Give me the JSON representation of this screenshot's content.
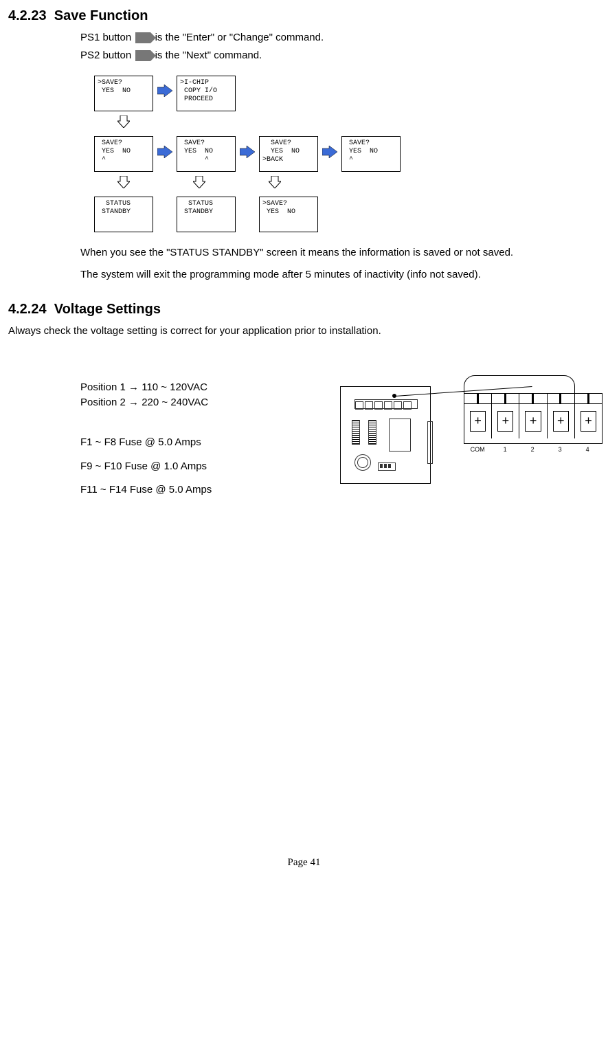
{
  "sec_save": {
    "num": "4.2.23",
    "title": "Save Function",
    "ps1_pre": "PS1 button",
    "ps1_post": " is the \"Enter\" or \"Change\" command.",
    "ps2_pre": "PS2 button",
    "ps2_post": " is the \"Next\" command.",
    "screens": {
      "r1c1": ">SAVE?\n YES  NO",
      "r1c2": ">I-CHIP\n COPY I/O\n PROCEED",
      "r2c1": " SAVE?\n YES  NO\n ^",
      "r2c2": " SAVE?\n YES  NO\n      ^",
      "r2c3": "  SAVE?\n  YES  NO\n>BACK",
      "r2c4": " SAVE?\n YES  NO\n ^",
      "r3c1": "  STATUS\n STANDBY",
      "r3c2": "  STATUS\n STANDBY",
      "r3c3": ">SAVE?\n YES  NO"
    },
    "note1": "When you see the \"STATUS STANDBY\" screen it means the information is saved or not saved.",
    "note2": "The system will exit the programming mode after 5 minutes of inactivity (info not saved)."
  },
  "sec_volt": {
    "num": "4.2.24",
    "title": "Voltage Settings",
    "intro": "Always check the voltage setting is correct for your application prior to installation.",
    "pos1": "Position 1  →    110 ~ 120VAC",
    "pos2": "Position 2  →    220 ~ 240VAC",
    "fuse_lines": [
      "F1 ~ F8 Fuse @ 5.0 Amps",
      "F9 ~ F10 Fuse @ 1.0 Amps",
      "F11 ~ F14 Fuse @ 5.0 Amps"
    ],
    "term_labels": [
      "COM",
      "1",
      "2",
      "3",
      "4"
    ]
  },
  "page_label": "Page 41"
}
